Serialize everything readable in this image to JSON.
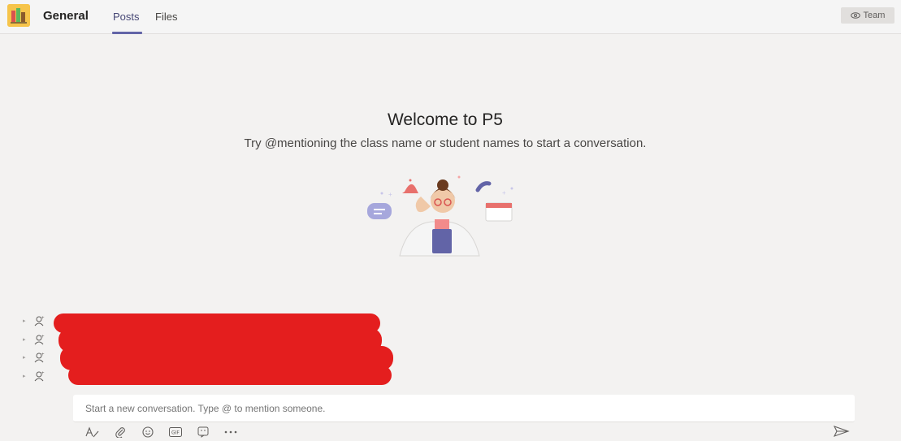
{
  "header": {
    "channel_name": "General",
    "tabs": [
      {
        "label": "Posts",
        "active": true
      },
      {
        "label": "Files",
        "active": false
      }
    ],
    "team_button_label": "Team"
  },
  "welcome": {
    "title": "Welcome to P5",
    "subtitle": "Try @mentioning the class name or student names to start a conversation."
  },
  "members": {
    "rows": 4
  },
  "compose": {
    "placeholder": "Start a new conversation. Type @ to mention someone."
  },
  "toolbar": {
    "icons": [
      "format-icon",
      "attach-icon",
      "emoji-icon",
      "gif-icon",
      "sticker-icon",
      "more-options-icon"
    ]
  },
  "colors": {
    "accent": "#6264a7",
    "background": "#f3f2f1",
    "redaction": "#e41e1e"
  }
}
